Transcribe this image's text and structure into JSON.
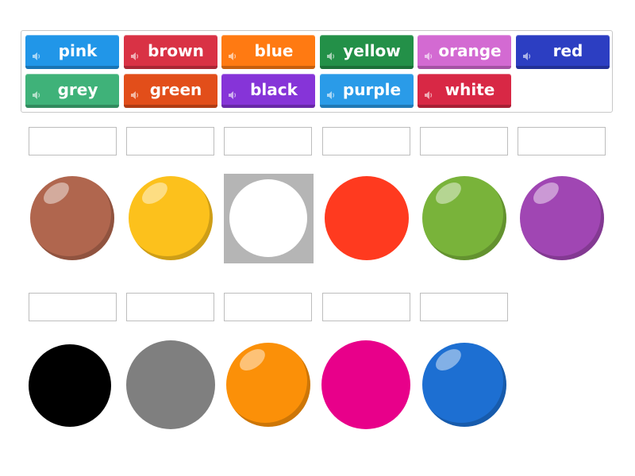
{
  "word_bank": [
    {
      "label": "pink",
      "color": "#2196e8"
    },
    {
      "label": "brown",
      "color": "#d93245"
    },
    {
      "label": "blue",
      "color": "#ff7a12"
    },
    {
      "label": "yellow",
      "color": "#239048"
    },
    {
      "label": "orange",
      "color": "#d36ad2"
    },
    {
      "label": "red",
      "color": "#2c3ec2"
    },
    {
      "label": "grey",
      "color": "#3fb279"
    },
    {
      "label": "green",
      "color": "#e24e1a"
    },
    {
      "label": "black",
      "color": "#8634d8"
    },
    {
      "label": "purple",
      "color": "#2a9be8"
    },
    {
      "label": "white",
      "color": "#d82845"
    }
  ],
  "speaker_icon": "speaker-icon",
  "color_swatches_row1": [
    {
      "color": "#b0664e"
    },
    {
      "color": "#fcc11c"
    },
    {
      "color": "#ffffff",
      "background": "#b5b5b5"
    },
    {
      "color": "#ff3a1f"
    },
    {
      "color": "#79b33a"
    },
    {
      "color": "#a046b3"
    }
  ],
  "color_swatches_row2": [
    {
      "color": "#000000"
    },
    {
      "color": "#7f7f7f"
    },
    {
      "color": "#fb9008"
    },
    {
      "color": "#e8008a"
    },
    {
      "color": "#1d6fd2"
    }
  ]
}
